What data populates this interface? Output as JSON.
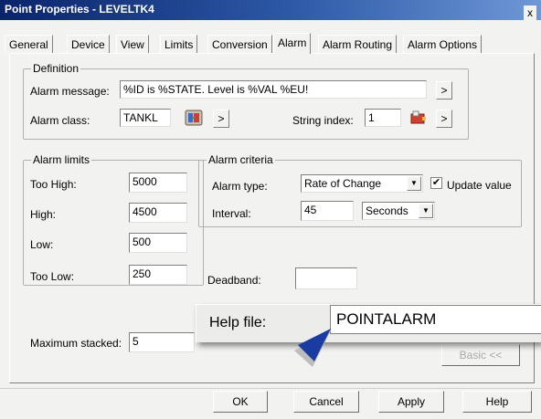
{
  "window": {
    "title": "Point Properties - LEVELTK4",
    "close_label": "x"
  },
  "tabs": [
    {
      "label": "General",
      "active": false
    },
    {
      "label": "Device",
      "active": false
    },
    {
      "label": "View",
      "active": false
    },
    {
      "label": "Limits",
      "active": false
    },
    {
      "label": "Conversion",
      "active": false
    },
    {
      "label": "Alarm",
      "active": true
    },
    {
      "label": "Alarm Routing",
      "active": false
    },
    {
      "label": "Alarm Options",
      "active": false
    }
  ],
  "definition": {
    "title": "Definition",
    "alarm_message_label": "Alarm message:",
    "alarm_message_value": "%ID is %STATE. Level is %VAL %EU!",
    "alarm_class_label": "Alarm class:",
    "alarm_class_value": "TANKL",
    "string_index_label": "String index:",
    "string_index_value": "1",
    "browse_label": ">"
  },
  "alarm_limits": {
    "title": "Alarm limits",
    "too_high_label": "Too High:",
    "too_high_value": "5000",
    "high_label": "High:",
    "high_value": "4500",
    "low_label": "Low:",
    "low_value": "500",
    "too_low_label": "Too Low:",
    "too_low_value": "250"
  },
  "alarm_criteria": {
    "title": "Alarm criteria",
    "alarm_type_label": "Alarm type:",
    "alarm_type_value": "Rate of Change",
    "update_value_label": "Update value",
    "update_value_checked": true,
    "interval_label": "Interval:",
    "interval_value": "45",
    "interval_unit": "Seconds"
  },
  "deadband": {
    "label": "Deadband:",
    "value": ""
  },
  "maximum_stacked": {
    "label": "Maximum stacked:",
    "value": "5"
  },
  "basic_button": "Basic <<",
  "callout": {
    "label": "Help file:",
    "value": "POINTALARM"
  },
  "buttons": {
    "ok": "OK",
    "cancel": "Cancel",
    "apply": "Apply",
    "help": "Help"
  },
  "colors": {
    "title_start": "#0a246a",
    "title_end": "#6e98d6",
    "pointer": "#1a3ca0"
  }
}
